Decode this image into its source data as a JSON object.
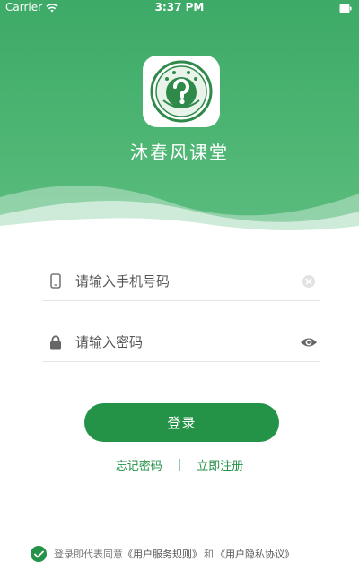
{
  "status_bar": {
    "carrier": "Carrier",
    "time": "3:37 PM",
    "wifi_icon": "wifi-icon",
    "battery_icon": "battery-icon"
  },
  "app": {
    "name": "沐春风课堂",
    "logo_icon": "app-logo-icon",
    "brand_color": "#249247"
  },
  "form": {
    "phone": {
      "placeholder": "请输入手机号码",
      "lead_icon": "phone-icon",
      "trail_icon": "clear-icon"
    },
    "password": {
      "placeholder": "请输入密码",
      "lead_icon": "lock-icon",
      "trail_icon": "eye-icon"
    }
  },
  "actions": {
    "login_label": "登录",
    "forgot_label": "忘记密码",
    "separator": "|",
    "register_label": "立即注册"
  },
  "agreement": {
    "checked": true,
    "prefix": "登录即代表同意",
    "terms_label": "《用户服务规则》",
    "conjunction": "和",
    "privacy_label": "《用户隐私协议》"
  }
}
